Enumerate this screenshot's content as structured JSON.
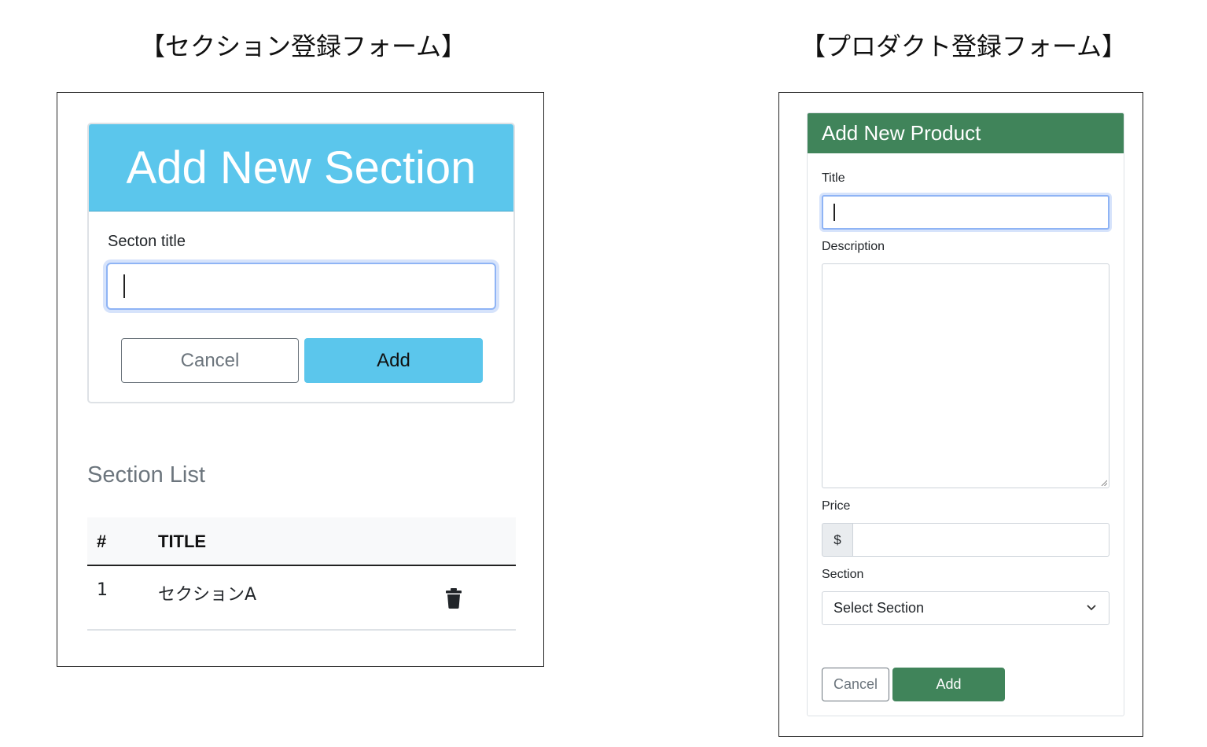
{
  "captions": {
    "left": "【セクション登録フォーム】",
    "right": "【プロダクト登録フォーム】"
  },
  "section_form": {
    "header": "Add New Section",
    "title_label": "Secton title",
    "title_value": "",
    "cancel_label": "Cancel",
    "add_label": "Add"
  },
  "section_list": {
    "heading": "Section List",
    "columns": [
      "#",
      "TITLE"
    ],
    "rows": [
      {
        "num": "1",
        "title": "セクションA",
        "action_icon": "trash-icon"
      }
    ]
  },
  "product_form": {
    "header": "Add New Product",
    "title_label": "Title",
    "title_value": "",
    "description_label": "Description",
    "description_value": "",
    "price_label": "Price",
    "price_prefix": "$",
    "price_value": "",
    "section_label": "Section",
    "section_selected": "Select Section",
    "cancel_label": "Cancel",
    "add_label": "Add"
  },
  "colors": {
    "section_accent": "#5bc6ec",
    "product_accent": "#40845a",
    "muted": "#6c757d",
    "focus_ring": "#8fb4f5"
  }
}
